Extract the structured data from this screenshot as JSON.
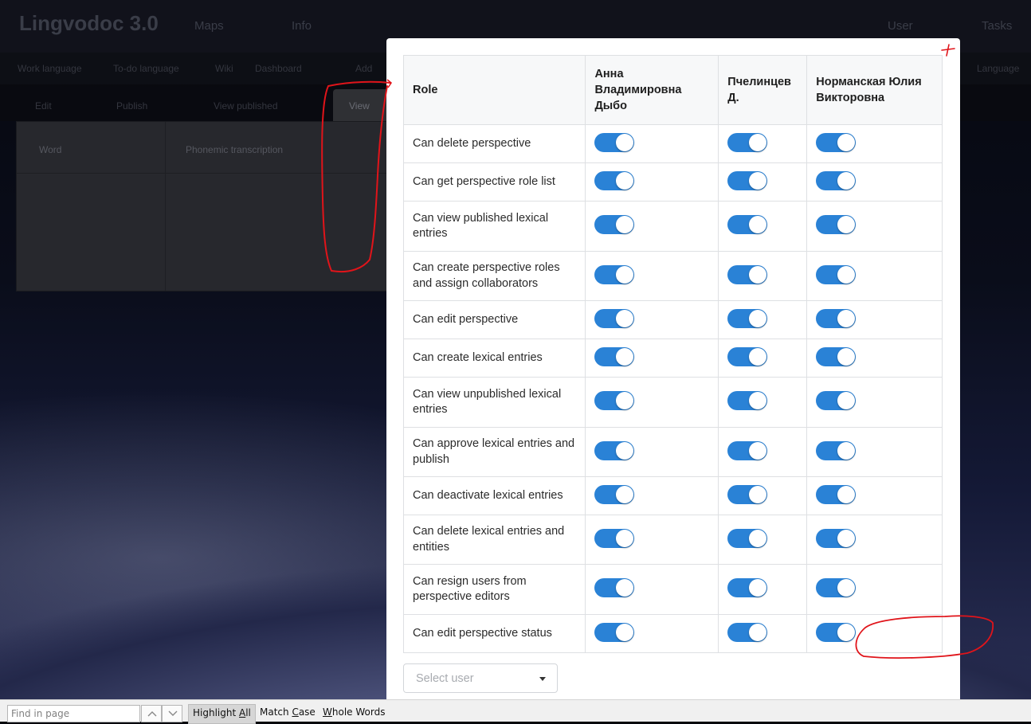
{
  "background_app": {
    "brand": "Lingvodoc 3.0",
    "menus": [
      "Maps",
      "Info",
      "User",
      "Tasks"
    ],
    "menubar_items": [
      "Work language",
      "To-do language",
      "Wiki",
      "Dashboard",
      "Add",
      "Language"
    ],
    "tabs": [
      "Edit",
      "Publish",
      "View published",
      "View"
    ],
    "panel_columns": [
      "Word",
      "Phonemic transcription"
    ]
  },
  "modal": {
    "table": {
      "headers": [
        "Role",
        "Анна Владимировна Дыбо",
        "Пчелинцев Д.",
        "Норманская Юлия Викторовна"
      ],
      "rows": [
        {
          "role": "Can delete perspective",
          "values": [
            true,
            true,
            true
          ]
        },
        {
          "role": "Can get perspective role list",
          "values": [
            true,
            true,
            true
          ]
        },
        {
          "role": "Can view published lexical entries",
          "values": [
            true,
            true,
            true
          ]
        },
        {
          "role": "Can create perspective roles and assign collaborators",
          "values": [
            true,
            true,
            true
          ]
        },
        {
          "role": "Can edit perspective",
          "values": [
            true,
            true,
            true
          ]
        },
        {
          "role": "Can create lexical entries",
          "values": [
            true,
            true,
            true
          ]
        },
        {
          "role": "Can view unpublished lexical entries",
          "values": [
            true,
            true,
            true
          ]
        },
        {
          "role": "Can approve lexical entries and publish",
          "values": [
            true,
            true,
            true
          ]
        },
        {
          "role": "Can deactivate lexical entries",
          "values": [
            true,
            true,
            true
          ]
        },
        {
          "role": "Can delete lexical entries and entities",
          "values": [
            true,
            true,
            true
          ]
        },
        {
          "role": "Can resign users from perspective editors",
          "values": [
            true,
            true,
            true
          ]
        },
        {
          "role": "Can edit perspective status",
          "values": [
            true,
            true,
            true
          ]
        }
      ]
    },
    "select_user": {
      "placeholder": "Select user"
    }
  },
  "findbar": {
    "placeholder": "Find in page",
    "highlight_all": {
      "pre": "Highlight ",
      "ul": "A",
      "post": "ll"
    },
    "match_case": {
      "pre": "Match ",
      "ul": "C",
      "post": "ase"
    },
    "whole_words": {
      "pre": "",
      "ul": "W",
      "post": "hole Words"
    }
  },
  "colors": {
    "toggle_on": "#2a82d6",
    "annotation_red": "#e0141a",
    "header_bg": "#f7f8f9"
  }
}
